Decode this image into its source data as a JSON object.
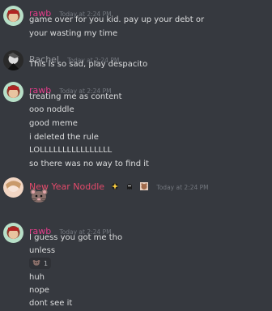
{
  "colors": {
    "rawb": "#e23d8a",
    "rachel": "#96989d",
    "noodle": "#e24a6a",
    "timestamp": "#72767d",
    "bg": "#36393f"
  },
  "messages": [
    {
      "author": "rawb",
      "timestamp": "Today at 2:24 PM",
      "lines": [
        "game over for you kid. pay up your debt or",
        "your wasting my time"
      ]
    },
    {
      "author": "Rachel",
      "timestamp": "Today at 2:24 PM",
      "lines": [
        "This is so sad, play despacito"
      ]
    },
    {
      "author": "rawb",
      "timestamp": "Today at 2:24 PM",
      "lines": [
        "treating me as content",
        "ooo noddle",
        "good meme",
        "i deleted the rule",
        "LOLLLLLLLLLLLLLLLL",
        "so there was no way to find it"
      ]
    },
    {
      "author": "New Year Noddle",
      "timestamp": "Today at 2:24 PM",
      "sticker": "rat-emoji",
      "badges": [
        "sparkle-badge-icon",
        "ghost-badge-icon",
        "bear-badge-icon"
      ]
    },
    {
      "author": "rawb",
      "timestamp": "Today at 2:24 PM",
      "lines": [
        "I guess you got me tho",
        "unless"
      ],
      "reaction": {
        "emoji": "rat-emoji",
        "count": "1"
      },
      "lines_after": [
        "huh",
        "nope",
        "dont see it"
      ]
    }
  ]
}
